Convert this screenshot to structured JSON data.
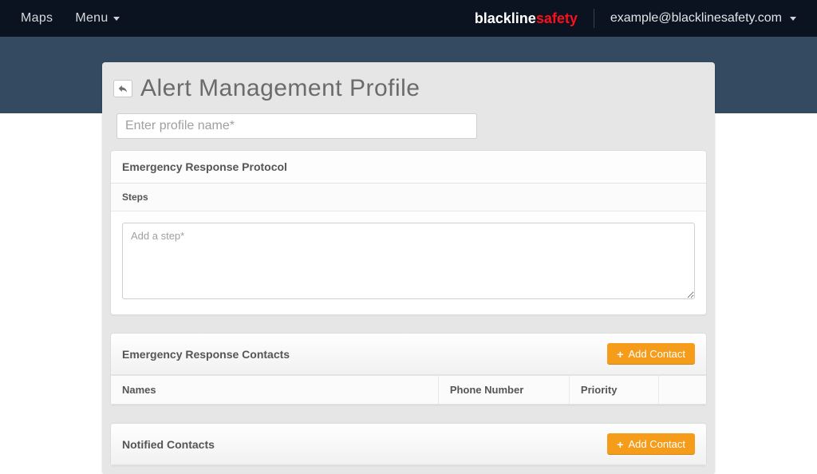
{
  "nav": {
    "maps": "Maps",
    "menu": "Menu",
    "brand_1": "blackline",
    "brand_2": "safety",
    "user_email": "example@blacklinesafety.com"
  },
  "page": {
    "title": "Alert Management Profile",
    "profile_name_placeholder": "Enter profile name*"
  },
  "protocol": {
    "title": "Emergency Response Protocol",
    "steps_label": "Steps",
    "step_placeholder": "Add a step*"
  },
  "contacts": {
    "title": "Emergency Response Contacts",
    "add_label": "Add Contact",
    "columns": {
      "names": "Names",
      "phone": "Phone Number",
      "priority": "Priority"
    }
  },
  "notified": {
    "title": "Notified Contacts",
    "add_label": "Add Contact"
  }
}
